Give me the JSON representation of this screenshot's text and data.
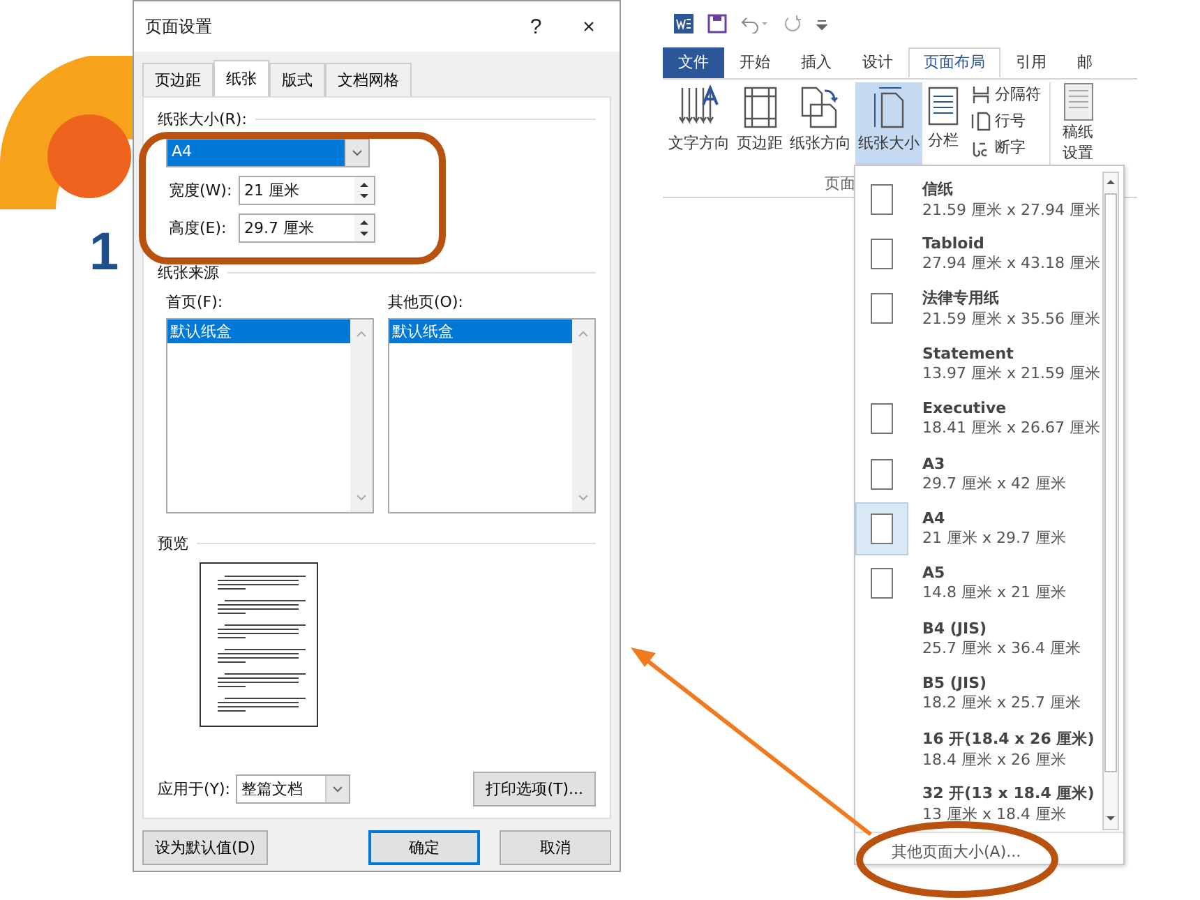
{
  "slide": {
    "heading_number": "1"
  },
  "dialog": {
    "title": "页面设置",
    "help": "?",
    "close": "×",
    "tabs": [
      {
        "label": "页边距",
        "selected": false
      },
      {
        "label": "纸张",
        "selected": true
      },
      {
        "label": "版式",
        "selected": false
      },
      {
        "label": "文档网格",
        "selected": false
      }
    ],
    "paper_size": {
      "label": "纸张大小(R):",
      "value": "A4",
      "width_label": "宽度(W):",
      "width": "21 厘米",
      "height_label": "高度(E):",
      "height": "29.7 厘米"
    },
    "paper_source": {
      "label": "纸张来源",
      "first_page": {
        "label": "首页(F):",
        "items": [
          {
            "text": "默认纸盒",
            "selected": true
          }
        ]
      },
      "other_pages": {
        "label": "其他页(O):",
        "items": [
          {
            "text": "默认纸盒",
            "selected": true
          }
        ]
      }
    },
    "preview": {
      "label": "预览"
    },
    "apply_to": {
      "label": "应用于(Y):",
      "value": "整篇文档"
    },
    "print_options": "打印选项(T)...",
    "buttons": [
      {
        "label": "设为默认值(D)",
        "kind": "plain"
      },
      {
        "label": "确定",
        "kind": "default"
      },
      {
        "label": "取消",
        "kind": "plain"
      }
    ]
  },
  "word": {
    "tabs": [
      {
        "label": "文件",
        "kind": "file",
        "selected": false
      },
      {
        "label": "开始",
        "kind": "tab",
        "selected": false
      },
      {
        "label": "插入",
        "kind": "tab",
        "selected": false
      },
      {
        "label": "设计",
        "kind": "tab",
        "selected": false
      },
      {
        "label": "页面布局",
        "kind": "tab",
        "selected": true
      },
      {
        "label": "引用",
        "kind": "tab",
        "selected": false
      },
      {
        "label": "邮",
        "kind": "tab",
        "selected": false
      }
    ],
    "ribbon_buttons": [
      {
        "label": "文字方向",
        "kind": "text-direction",
        "selected": false
      },
      {
        "label": "页边距",
        "kind": "margins",
        "selected": false
      },
      {
        "label": "纸张方向",
        "kind": "orientation",
        "selected": false
      },
      {
        "label": "纸张大小",
        "kind": "size",
        "selected": true
      },
      {
        "label": "分栏",
        "kind": "columns",
        "selected": false
      }
    ],
    "small_buttons": [
      {
        "label": "分隔符",
        "kind": "breaks"
      },
      {
        "label": "行号",
        "kind": "line-numbers"
      },
      {
        "label": "断字",
        "kind": "hyphenation"
      }
    ],
    "draft_button": "稿纸设置",
    "group_label": "页面",
    "size_menu": {
      "items": [
        {
          "name": "信纸",
          "size": "21.59 厘米 x 27.94 厘米",
          "kind": "paper",
          "selected": false
        },
        {
          "name": "Tabloid",
          "size": "27.94 厘米 x 43.18 厘米",
          "kind": "paper",
          "selected": false
        },
        {
          "name": "法律专用纸",
          "size": "21.59 厘米 x 35.56 厘米",
          "kind": "paper",
          "selected": false
        },
        {
          "name": "Statement",
          "size": "13.97 厘米 x 21.59 厘米",
          "kind": "plain",
          "selected": false
        },
        {
          "name": "Executive",
          "size": "18.41 厘米 x 26.67 厘米",
          "kind": "paper",
          "selected": false
        },
        {
          "name": "A3",
          "size": "29.7 厘米 x 42 厘米",
          "kind": "paper",
          "selected": false
        },
        {
          "name": "A4",
          "size": "21 厘米 x 29.7 厘米",
          "kind": "paper",
          "selected": true
        },
        {
          "name": "A5",
          "size": "14.8 厘米 x 21 厘米",
          "kind": "paper",
          "selected": false
        },
        {
          "name": "B4 (JIS)",
          "size": "25.7 厘米 x 36.4 厘米",
          "kind": "plain",
          "selected": false
        },
        {
          "name": "B5 (JIS)",
          "size": "18.2 厘米 x 25.7 厘米",
          "kind": "plain",
          "selected": false
        },
        {
          "name": "16 开(18.4 x 26 厘米)",
          "size": "18.4 厘米 x 26 厘米",
          "kind": "plain",
          "selected": false
        },
        {
          "name": "32 开(13 x 18.4 厘米)",
          "size": "13 厘米 x 18.4 厘米",
          "kind": "plain",
          "selected": false
        }
      ],
      "more": "其他页面大小(A)..."
    }
  }
}
